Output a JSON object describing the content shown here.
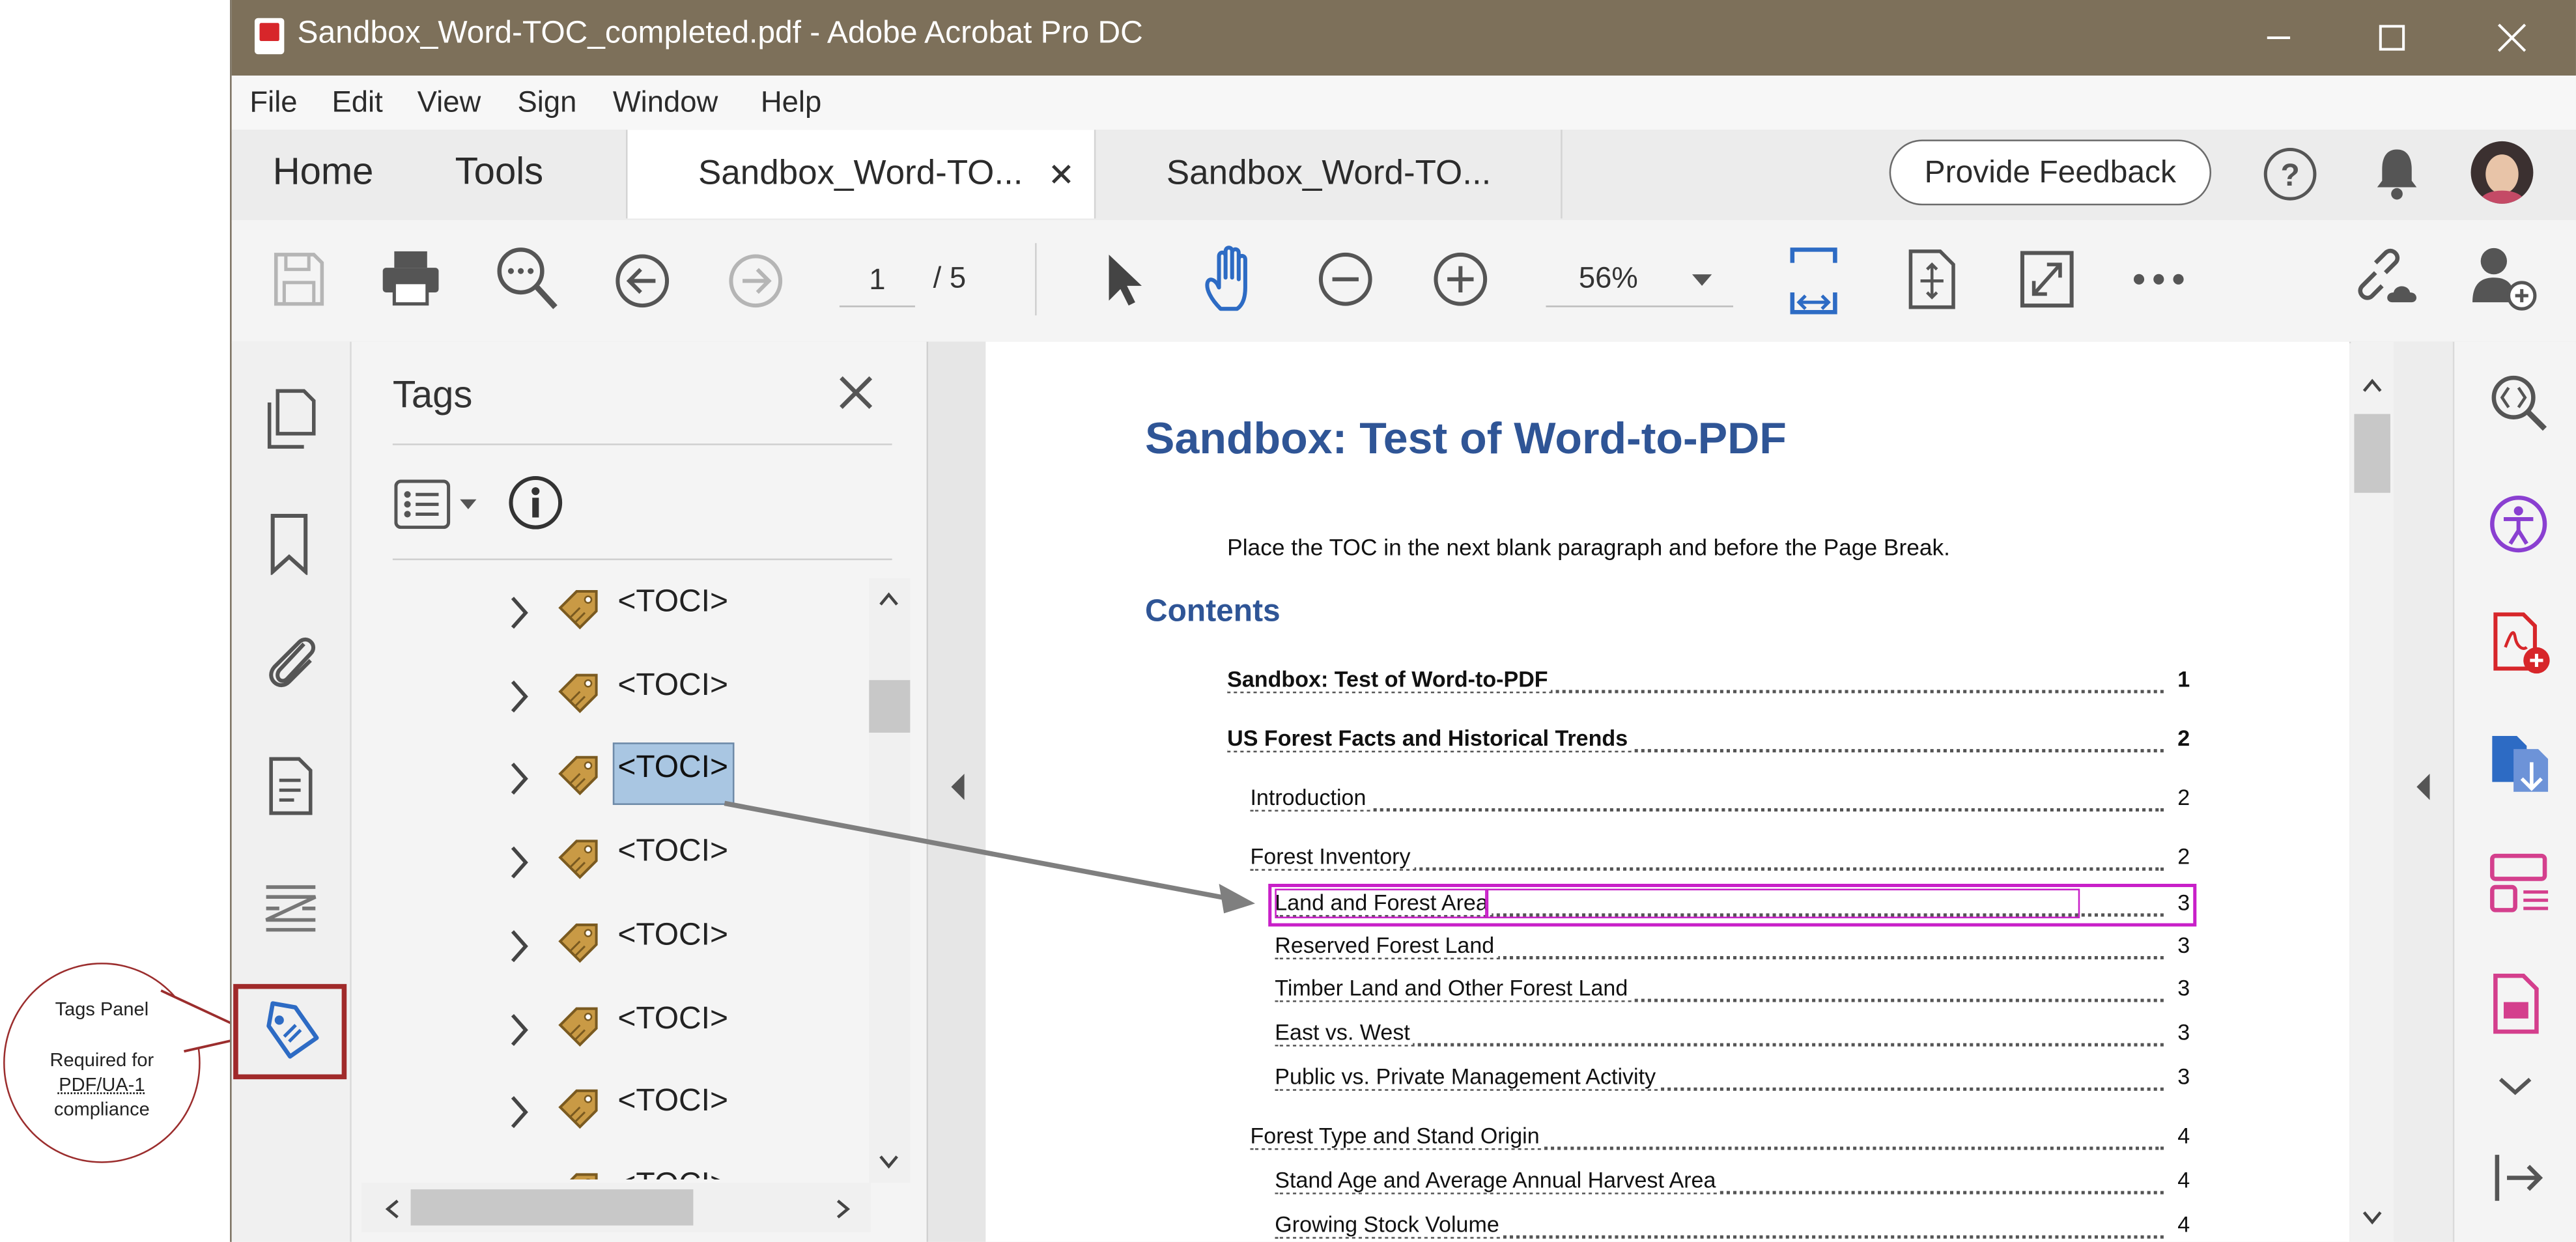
{
  "window": {
    "title": "Sandbox_Word-TOC_completed.pdf - Adobe Acrobat Pro DC",
    "title_bar_color": "#7d705a"
  },
  "menu": {
    "items": [
      "File",
      "Edit",
      "View",
      "Sign",
      "Window",
      "Help"
    ]
  },
  "tabs": {
    "home": "Home",
    "tools": "Tools",
    "doc_tabs": [
      {
        "label": "Sandbox_Word-TO...",
        "active": true
      },
      {
        "label": "Sandbox_Word-TO...",
        "active": false
      }
    ],
    "feedback": "Provide Feedback"
  },
  "toolbar": {
    "page_current": "1",
    "page_total": "/ 5",
    "zoom": "56%",
    "accent_color": "#2d6bc4"
  },
  "left_rail": {
    "icons": [
      "page-thumbnails-icon",
      "bookmarks-icon",
      "attachments-icon",
      "content-icon",
      "order-icon",
      "tags-icon"
    ]
  },
  "tags_panel": {
    "title": "Tags",
    "rows": [
      {
        "label": "<TOCI>",
        "selected": false
      },
      {
        "label": "<TOCI>",
        "selected": false
      },
      {
        "label": "<TOCI>",
        "selected": true
      },
      {
        "label": "<TOCI>",
        "selected": false
      },
      {
        "label": "<TOCI>",
        "selected": false
      },
      {
        "label": "<TOCI>",
        "selected": false
      },
      {
        "label": "<TOCI>",
        "selected": false
      },
      {
        "label": "<TOCI>",
        "selected": false
      }
    ],
    "selection_color": "#a9c6e2"
  },
  "document": {
    "heading": "Sandbox: Test of Word-to-PDF",
    "heading_color": "#2f5596",
    "intro": "Place the TOC in the next blank paragraph and before the Page Break.",
    "contents_heading": "Contents",
    "toc": [
      {
        "text": "Sandbox: Test of Word-to-PDF",
        "page": "1",
        "level": 0,
        "bold": true
      },
      {
        "text": "US Forest Facts and Historical Trends",
        "page": "2",
        "level": 0,
        "bold": true
      },
      {
        "text": "Introduction",
        "page": "2",
        "level": 1,
        "bold": false
      },
      {
        "text": "Forest Inventory",
        "page": "2",
        "level": 1,
        "bold": false
      },
      {
        "text": "Land and Forest Area",
        "page": "3",
        "level": 2,
        "bold": false,
        "highlighted": true
      },
      {
        "text": "Reserved Forest Land",
        "page": "3",
        "level": 2,
        "bold": false
      },
      {
        "text": "Timber Land and Other Forest Land",
        "page": "3",
        "level": 2,
        "bold": false
      },
      {
        "text": "East vs. West",
        "page": "3",
        "level": 2,
        "bold": false
      },
      {
        "text": "Public vs. Private Management Activity",
        "page": "3",
        "level": 2,
        "bold": false
      },
      {
        "text": "Forest Type and Stand Origin",
        "page": "4",
        "level": 1,
        "bold": false
      },
      {
        "text": "Stand Age and Average Annual Harvest Area",
        "page": "4",
        "level": 2,
        "bold": false
      },
      {
        "text": "Growing Stock Volume",
        "page": "4",
        "level": 2,
        "bold": false
      }
    ],
    "highlight_color": "#c81fc8"
  },
  "callout": {
    "line1": "Tags Panel",
    "line2": "Required for",
    "line3": "PDF/UA-1",
    "line4": "compliance",
    "border_color": "#9b2d2d"
  }
}
